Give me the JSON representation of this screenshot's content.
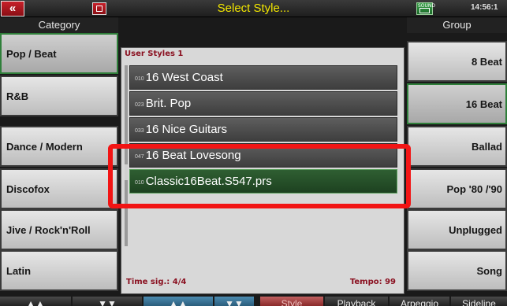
{
  "topbar": {
    "back_label": "«",
    "title": "Select Style...",
    "rec_label": "SOUND",
    "clock": "14:56:1"
  },
  "left": {
    "header": "Category",
    "items": [
      {
        "label": "Pop / Beat",
        "active": true
      },
      {
        "label": "R&B",
        "active": false
      },
      {
        "label": "Dance / Modern",
        "active": false
      },
      {
        "label": "Discofox",
        "active": false
      },
      {
        "label": "Jive / Rock'n'Roll",
        "active": false
      },
      {
        "label": "Latin",
        "active": false
      }
    ]
  },
  "right": {
    "header": "Group",
    "items": [
      {
        "label": "8 Beat",
        "active": false
      },
      {
        "label": "16 Beat",
        "active": true
      },
      {
        "label": "Ballad",
        "active": false
      },
      {
        "label": "Pop '80 /'90",
        "active": false
      },
      {
        "label": "Unplugged",
        "active": false
      },
      {
        "label": "Song",
        "active": false
      }
    ]
  },
  "center": {
    "header": "User Styles 1",
    "rows": [
      {
        "num": "010",
        "name": "16 West Coast",
        "selected": false
      },
      {
        "num": "023",
        "name": "Brit. Pop",
        "selected": false
      },
      {
        "num": "033",
        "name": "16 Nice Guitars",
        "selected": false
      },
      {
        "num": "047",
        "name": "16 Beat Lovesong",
        "selected": false
      },
      {
        "num": "010",
        "name": "Classic16Beat.S547.prs",
        "selected": true
      }
    ],
    "time_sig": "Time sig.: 4/4",
    "tempo": "Tempo: 99"
  },
  "bottom": {
    "buttons": [
      {
        "label": "▲▲",
        "style": "dark"
      },
      {
        "label": "▼▼",
        "style": "dark"
      },
      {
        "label": "▲▲",
        "style": "blue"
      },
      {
        "label": "▼▼",
        "style": "blue"
      },
      {
        "label": "Style",
        "style": "red"
      },
      {
        "label": "Playback",
        "style": "dark"
      },
      {
        "label": "Arpeggio",
        "style": "dark"
      },
      {
        "label": "Sideline",
        "style": "dark"
      }
    ]
  }
}
